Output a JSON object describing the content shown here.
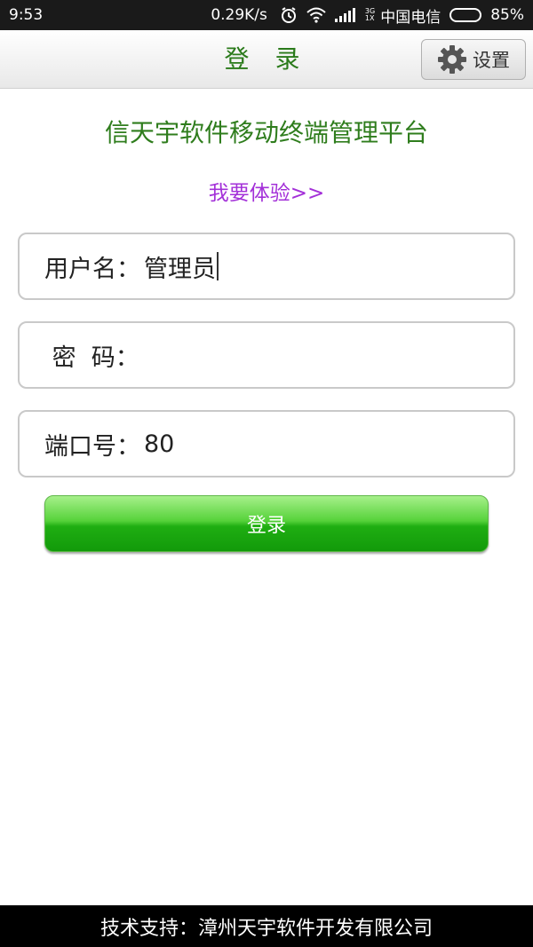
{
  "status_bar": {
    "time": "9:53",
    "net_speed": "0.29K/s",
    "signal_top": "3G",
    "signal_bottom": "1X",
    "carrier": "中国电信",
    "battery": "85%",
    "battery_level": 0.85
  },
  "header": {
    "title": "登 录",
    "settings_label": "设置"
  },
  "main": {
    "heading": "信天宇软件移动终端管理平台",
    "try_link": "我要体验>>",
    "fields": {
      "username": {
        "label": "用户名：",
        "value": "管理员"
      },
      "password": {
        "label": " 密  码：",
        "value": ""
      },
      "port": {
        "label": "端口号：",
        "value": "80"
      }
    },
    "login_button": "登录"
  },
  "footer": {
    "text": "技术支持：漳州天宇软件开发有限公司"
  },
  "colors": {
    "title_green": "#2a7a1a",
    "heading_green": "#2f7d1d",
    "link_purple": "#a330d8",
    "button_green": "#1fae12"
  }
}
